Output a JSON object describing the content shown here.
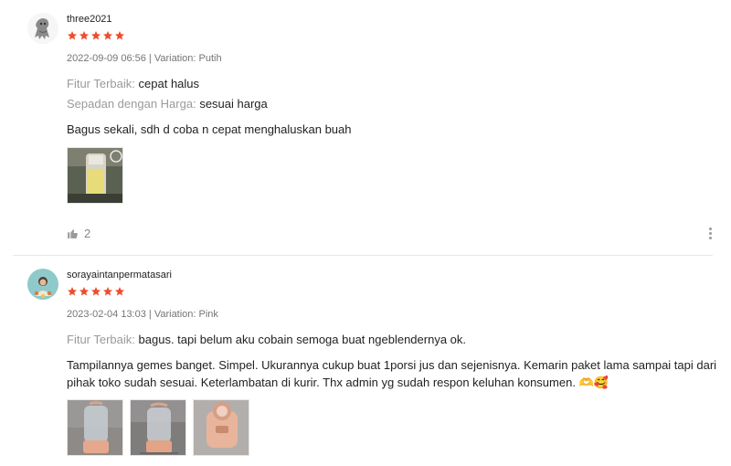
{
  "colors": {
    "star": "#ee4d2d",
    "muted": "#757575",
    "label": "#9a9a9a"
  },
  "reviews": [
    {
      "username": "three2021",
      "rating": 5,
      "datetime_variation": "2022-09-09 06:56 | Variation: Putih",
      "attributes": [
        {
          "label": "Fitur Terbaik:",
          "value": "cepat halus"
        },
        {
          "label": "Sepadan dengan Harga:",
          "value": "sesuai harga"
        }
      ],
      "text": "Bagus sekali, sdh d coba n cepat menghaluskan buah",
      "photo_count": 1,
      "likes": "2",
      "icons": {
        "like": "thumbs-up-icon",
        "more": "more-vertical-icon"
      }
    },
    {
      "username": "sorayaintanpermatasari",
      "rating": 5,
      "datetime_variation": "2023-02-04 13:03 | Variation: Pink",
      "attributes": [
        {
          "label": "Fitur Terbaik:",
          "value": "bagus. tapi belum aku cobain semoga buat ngeblendernya ok."
        }
      ],
      "text": "Tampilannya gemes banget. Simpel. Ukurannya cukup buat 1porsi jus dan sejenisnya. Kemarin paket lama sampai tapi dari pihak toko sudah sesuai. Keterlambatan di kurir. Thx admin yg sudah respon keluhan konsumen. 🫶🥰",
      "photo_count": 3
    }
  ]
}
